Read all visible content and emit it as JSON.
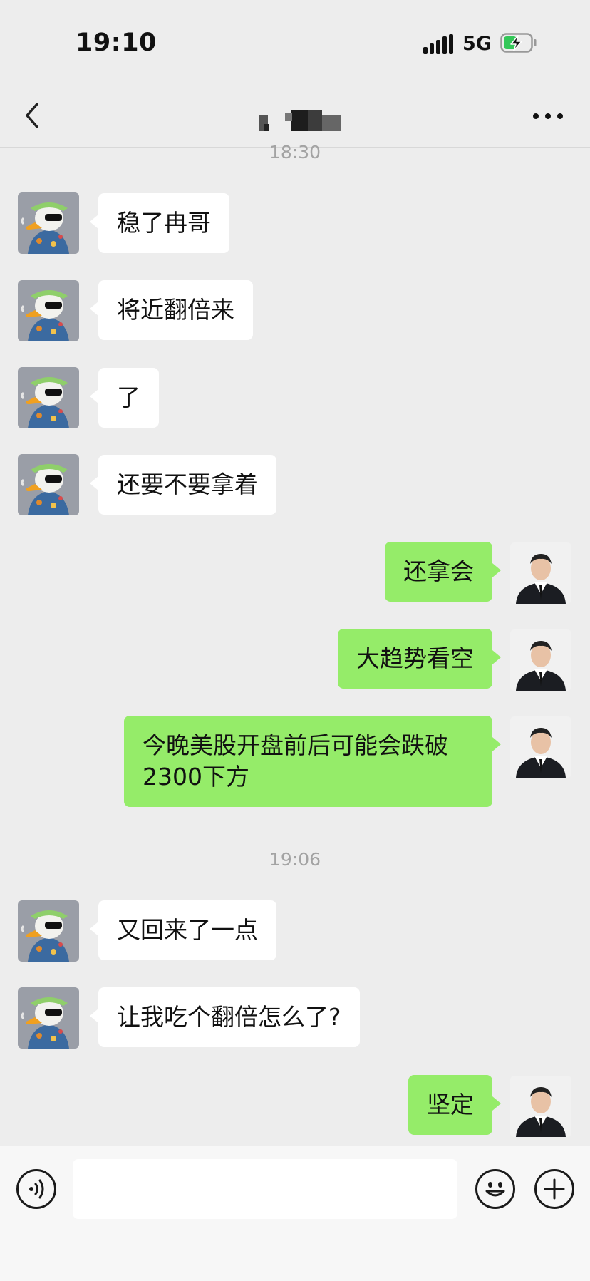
{
  "status_bar": {
    "time": "19:10",
    "network": "5G"
  },
  "nav": {
    "title": ""
  },
  "messages": [
    {
      "type": "time",
      "text": "18:30"
    },
    {
      "type": "msg",
      "side": "in",
      "text": "稳了冉哥"
    },
    {
      "type": "msg",
      "side": "in",
      "text": "将近翻倍来"
    },
    {
      "type": "msg",
      "side": "in",
      "text": "了"
    },
    {
      "type": "msg",
      "side": "in",
      "text": "还要不要拿着"
    },
    {
      "type": "msg",
      "side": "out",
      "text": "还拿会"
    },
    {
      "type": "msg",
      "side": "out",
      "text": "大趋势看空"
    },
    {
      "type": "msg",
      "side": "out",
      "text": "今晚美股开盘前后可能会跌破\n2300下方"
    },
    {
      "type": "time",
      "text": "19:06"
    },
    {
      "type": "msg",
      "side": "in",
      "text": "又回来了一点"
    },
    {
      "type": "msg",
      "side": "in",
      "text": "让我吃个翻倍怎么了?"
    },
    {
      "type": "msg",
      "side": "out",
      "text": "坚定"
    }
  ],
  "input": {
    "placeholder": ""
  },
  "icons": {
    "back": "chevron-left-icon",
    "more": "more-dots-icon",
    "voice": "voice-icon",
    "emoji": "emoji-icon",
    "add": "plus-icon"
  },
  "colors": {
    "background": "#ededed",
    "bubble_in": "#ffffff",
    "bubble_out": "#95ec69",
    "battery_charge": "#34c759"
  }
}
